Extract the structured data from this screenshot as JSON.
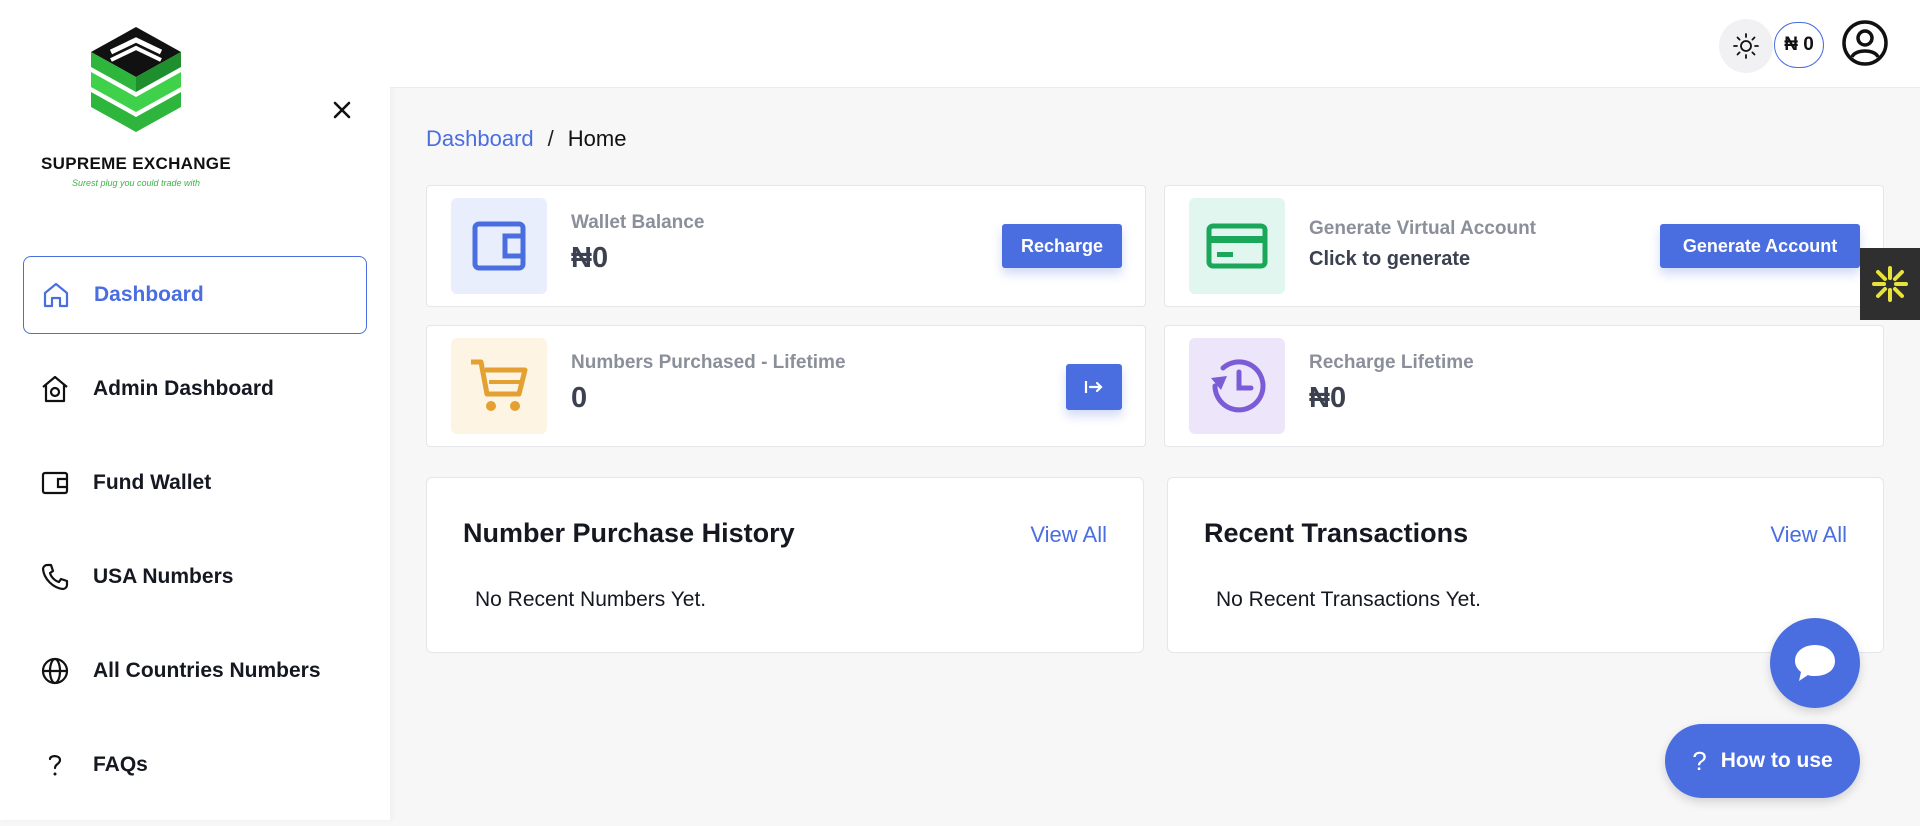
{
  "brand": {
    "name": "SUPREME EXCHANGE",
    "tagline": "Surest plug you could trade with"
  },
  "sidebar": {
    "items": [
      {
        "label": "Dashboard",
        "icon": "home-icon",
        "active": true
      },
      {
        "label": "Admin Dashboard",
        "icon": "admin-home-icon"
      },
      {
        "label": "Fund Wallet",
        "icon": "wallet-icon"
      },
      {
        "label": "USA Numbers",
        "icon": "phone-icon"
      },
      {
        "label": "All Countries Numbers",
        "icon": "globe-icon"
      },
      {
        "label": "FAQs",
        "icon": "question-icon"
      }
    ]
  },
  "header": {
    "balance": "₦ 0",
    "theme_icon": "sun-icon",
    "user_icon": "user-circle-icon"
  },
  "breadcrumb": {
    "parent": "Dashboard",
    "separator": "/",
    "current": "Home"
  },
  "cards": {
    "wallet": {
      "title": "Wallet Balance",
      "value": "₦0",
      "button": "Recharge",
      "icon": "wallet-icon",
      "color": "#4a6ee0",
      "bg": "#e8eefc"
    },
    "virtual": {
      "title": "Generate Virtual Account",
      "value": "Click to generate",
      "button": "Generate Account",
      "icon": "credit-card-icon",
      "color": "#1aa75a",
      "bg": "#e0f6ee"
    },
    "numbers": {
      "title": "Numbers Purchased - Lifetime",
      "value": "0",
      "icon": "cart-icon",
      "color": "#e4a030",
      "bg": "#fdf4e4",
      "action_icon": "arrow-right-icon"
    },
    "recharge": {
      "title": "Recharge Lifetime",
      "value": "₦0",
      "icon": "history-icon",
      "color": "#7b5cd6",
      "bg": "#ede6fa"
    }
  },
  "history": {
    "purchases": {
      "title": "Number Purchase History",
      "link": "View All",
      "empty": "No Recent Numbers Yet."
    },
    "transactions": {
      "title": "Recent Transactions",
      "link": "View All",
      "empty": "No Recent Transactions Yet."
    }
  },
  "floating": {
    "how_to": "How to use",
    "chat_icon": "chat-bubble-icon",
    "side_icon": "asterisk-icon"
  }
}
